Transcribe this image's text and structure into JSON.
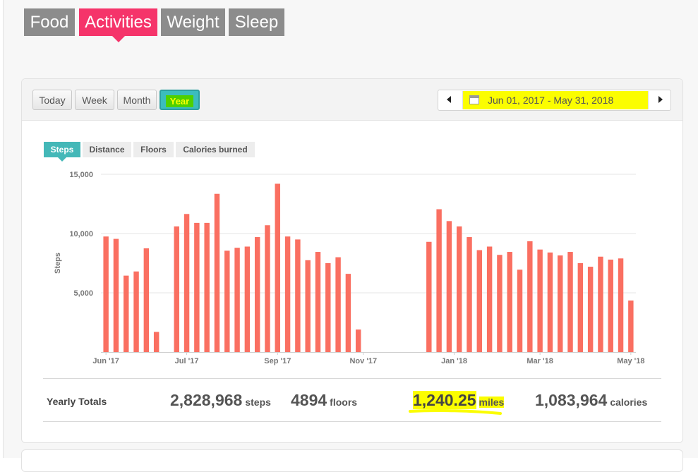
{
  "top_tabs": [
    {
      "label": "Food"
    },
    {
      "label": "Activities"
    },
    {
      "label": "Weight"
    },
    {
      "label": "Sleep"
    }
  ],
  "active_top_tab": "Activities",
  "range_buttons": [
    {
      "label": "Today"
    },
    {
      "label": "Week"
    },
    {
      "label": "Month"
    },
    {
      "label": "Year"
    }
  ],
  "active_range": "Year",
  "date_range": {
    "label": "Jun 01, 2017 - May 31, 2018",
    "prev_icon": "triangle-left-icon",
    "next_icon": "triangle-right-icon",
    "calendar_icon": "calendar-icon"
  },
  "metric_tabs": [
    {
      "label": "Steps"
    },
    {
      "label": "Distance"
    },
    {
      "label": "Floors"
    },
    {
      "label": "Calories burned"
    }
  ],
  "active_metric": "Steps",
  "chart_data": {
    "type": "bar",
    "ylabel": "Steps",
    "xlabel": "",
    "ylim": [
      0,
      15000
    ],
    "y_ticks": [
      {
        "value": 15000,
        "label": "15,000"
      },
      {
        "value": 10000,
        "label": "10,000"
      },
      {
        "value": 5000,
        "label": "5,000"
      }
    ],
    "x_ticks": [
      {
        "index": 0.5,
        "label": "Jun '17"
      },
      {
        "index": 8.5,
        "label": "Jul '17"
      },
      {
        "index": 17.5,
        "label": "Sep '17"
      },
      {
        "index": 26,
        "label": "Nov '17"
      },
      {
        "index": 35,
        "label": "Jan '18"
      },
      {
        "index": 43.5,
        "label": "Mar '18"
      },
      {
        "index": 52.5,
        "label": "May '18"
      }
    ],
    "grid": true,
    "bar_color": "#fa6f61",
    "values": [
      9750,
      9550,
      6450,
      6800,
      8750,
      1700,
      null,
      10600,
      11650,
      10900,
      10900,
      13350,
      8550,
      8800,
      8900,
      9700,
      10700,
      14200,
      9750,
      9500,
      7750,
      8450,
      7500,
      8000,
      6600,
      1900,
      null,
      null,
      null,
      null,
      null,
      null,
      9300,
      12050,
      11050,
      10600,
      9700,
      8600,
      8900,
      8200,
      8450,
      6950,
      9350,
      8650,
      8400,
      8150,
      8450,
      7500,
      7200,
      8050,
      7800,
      7900,
      4350
    ]
  },
  "totals": {
    "label": "Yearly Totals",
    "steps": {
      "value": "2,828,968",
      "unit": "steps"
    },
    "floors": {
      "value": "4894",
      "unit": "floors"
    },
    "miles": {
      "value": "1,240.25",
      "unit": "miles"
    },
    "calories": {
      "value": "1,083,964",
      "unit": "calories"
    }
  },
  "colors": {
    "active_top_tab": "#f5346a",
    "inactive_top_tab": "#8c8c8c",
    "teal": "#44b8b8",
    "highlight": "#fbfd00",
    "bar": "#fa6f61"
  }
}
